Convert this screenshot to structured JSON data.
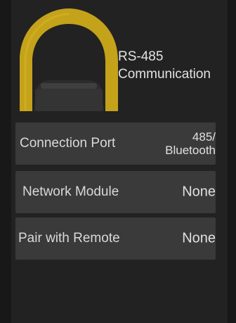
{
  "device": {
    "icon": "rs485-device-icon",
    "title_line1": "RS-485",
    "title_line2": "Communication",
    "accent_color": "#c4a21a"
  },
  "settings": [
    {
      "label": "Connection Port",
      "value_line1": "485/",
      "value_line2": "Bluetooth"
    },
    {
      "label": "Network Module",
      "value": "None"
    },
    {
      "label": "Pair with Remote",
      "value": "None"
    }
  ]
}
